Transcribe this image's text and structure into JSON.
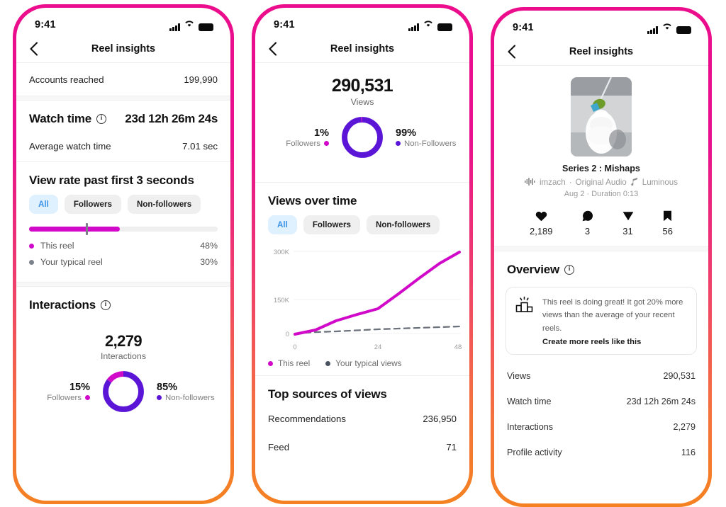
{
  "status_bar": {
    "time": "9:41",
    "signal_icon": "cellular-bars-icon",
    "wifi_icon": "wifi-icon",
    "battery_icon": "battery-icon"
  },
  "nav": {
    "title": "Reel insights",
    "back_icon": "chevron-left-icon"
  },
  "colors": {
    "magenta": "#d00ac8",
    "purple": "#5b15d6",
    "pink_frame": "#ec0d8c",
    "orange_frame": "#f58220",
    "pill_active_bg": "#dff0ff",
    "pill_active_text": "#3a93e8",
    "gray_line": "#6d737d"
  },
  "screen1": {
    "accounts_reached": {
      "label": "Accounts reached",
      "value": "199,990"
    },
    "watch_time": {
      "label": "Watch time",
      "info_icon": "info-circle-icon",
      "value": "23d 12h 26m 24s"
    },
    "avg_watch_time": {
      "label": "Average watch time",
      "value": "7.01 sec"
    },
    "view_rate": {
      "title": "View rate past first 3 seconds",
      "tabs": [
        {
          "label": "All",
          "active": true
        },
        {
          "label": "Followers",
          "active": false
        },
        {
          "label": "Non-followers",
          "active": false
        }
      ],
      "bar": {
        "fill_percent": 48,
        "tick_percent": 30
      },
      "legend": [
        {
          "label": "This reel",
          "value": "48%",
          "color": "#d00ac8"
        },
        {
          "label": "Your typical reel",
          "value": "30%",
          "color": "#7d838d"
        }
      ]
    },
    "interactions": {
      "title": "Interactions",
      "info_icon": "info-circle-icon",
      "total": "2,279",
      "total_caption": "Interactions",
      "left": {
        "pct": "15%",
        "caption": "Followers",
        "color": "#d00ac8"
      },
      "right": {
        "pct": "85%",
        "caption": "Non-followers",
        "color": "#5b15d6"
      }
    }
  },
  "screen2": {
    "views": {
      "total": "290,531",
      "caption": "Views",
      "left": {
        "pct": "1%",
        "caption": "Followers",
        "color": "#d00ac8"
      },
      "right": {
        "pct": "99%",
        "caption": "Non-Followers",
        "color": "#5b15d6"
      }
    },
    "views_over_time": {
      "title": "Views over time",
      "tabs": [
        {
          "label": "All",
          "active": true
        },
        {
          "label": "Followers",
          "active": false
        },
        {
          "label": "Non-followers",
          "active": false
        }
      ],
      "legend": [
        {
          "label": "This reel",
          "color": "#d00ac8"
        },
        {
          "label": "Your typical views",
          "color": "#4a5160"
        }
      ]
    },
    "top_sources": {
      "title": "Top sources of views",
      "rows": [
        {
          "label": "Recommendations",
          "value": "236,950"
        },
        {
          "label": "Feed",
          "value": "71",
          "partial": true
        }
      ]
    }
  },
  "screen3": {
    "reel": {
      "thumbnail_icon": "reel-thumbnail",
      "title": "Series 2 : Mishaps",
      "audio_icon": "audio-waveform-icon",
      "author": "imzach",
      "audio_label": "Original Audio",
      "remix_icon": "remix-icon",
      "track": "Luminous",
      "date_duration": "Aug 2 · Duration 0:13"
    },
    "stats": [
      {
        "icon": "heart-icon",
        "value": "2,189"
      },
      {
        "icon": "comment-icon",
        "value": "3"
      },
      {
        "icon": "share-icon",
        "value": "31"
      },
      {
        "icon": "bookmark-icon",
        "value": "56"
      }
    ],
    "overview": {
      "title": "Overview",
      "info_icon": "info-circle-icon",
      "tip_icon": "podium-chart-icon",
      "tip_text": "This reel is doing great! It got 20% more views than the average of your recent reels.",
      "tip_cta": "Create more reels like this",
      "rows": [
        {
          "label": "Views",
          "value": "290,531"
        },
        {
          "label": "Watch time",
          "value": "23d 12h 26m 24s"
        },
        {
          "label": "Interactions",
          "value": "2,279"
        },
        {
          "label": "Profile activity",
          "value": "116"
        }
      ]
    }
  },
  "chart_data": [
    {
      "type": "pie",
      "title": "Interactions",
      "center_label": "2,279",
      "center_sublabel": "Interactions",
      "labels": [
        "Followers",
        "Non-followers"
      ],
      "values": [
        15,
        85
      ],
      "colors": [
        "#d00ac8",
        "#5b15d6"
      ],
      "unit": "percent"
    },
    {
      "type": "pie",
      "title": "Views",
      "center_label": "290,531",
      "center_sublabel": "Views",
      "labels": [
        "Followers",
        "Non-Followers"
      ],
      "values": [
        1,
        99
      ],
      "colors": [
        "#d00ac8",
        "#5b15d6"
      ],
      "unit": "percent"
    },
    {
      "type": "line",
      "title": "Views over time",
      "xlabel": "",
      "ylabel": "",
      "x": [
        0,
        6,
        12,
        18,
        24,
        30,
        36,
        42,
        48
      ],
      "xticks": [
        "0",
        "24",
        "48"
      ],
      "xtick_values": [
        0,
        24,
        48
      ],
      "yticks": [
        "0",
        "150K",
        "300K"
      ],
      "ytick_values": [
        0,
        150000,
        300000
      ],
      "ylim": [
        0,
        320000
      ],
      "xlim": [
        0,
        48
      ],
      "grid": true,
      "legend_position": "bottom-left",
      "series": [
        {
          "name": "This reel",
          "color": "#d00ac8",
          "style": "solid",
          "values": [
            0,
            12000,
            38000,
            58000,
            76000,
            130000,
            185000,
            238000,
            287000
          ]
        },
        {
          "name": "Your typical views",
          "color": "#6d737d",
          "style": "dashed",
          "values": [
            0,
            2000,
            5000,
            7500,
            10000,
            12500,
            15000,
            17500,
            20000
          ]
        }
      ]
    },
    {
      "type": "bar",
      "title": "View rate past first 3 seconds",
      "categories": [
        "This reel",
        "Your typical reel"
      ],
      "values": [
        48,
        30
      ],
      "unit": "percent",
      "ylim": [
        0,
        100
      ]
    }
  ]
}
